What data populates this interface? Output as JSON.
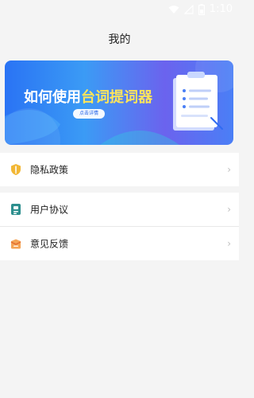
{
  "status_bar": {
    "time": "1:10",
    "icons": [
      "wifi-icon",
      "signal-icon",
      "battery-icon"
    ]
  },
  "header": {
    "title": "我的"
  },
  "banner": {
    "text_part1": "如何使用",
    "text_highlight": "台词提词器",
    "button_label": "点击详情",
    "colors": {
      "gradient_start": "#2a73f4",
      "gradient_end": "#6b63ee",
      "highlight": "#ffe55a"
    }
  },
  "menu": {
    "group1": [
      {
        "label": "隐私政策",
        "icon": "shield-icon"
      }
    ],
    "group2": [
      {
        "label": "用户协议",
        "icon": "document-icon"
      },
      {
        "label": "意见反馈",
        "icon": "feedback-box-icon"
      }
    ]
  }
}
